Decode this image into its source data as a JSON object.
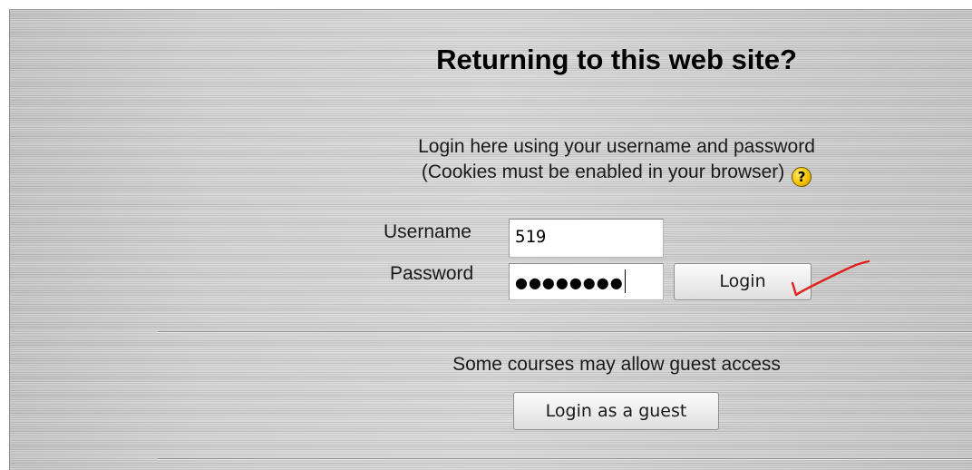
{
  "login_page": {
    "heading": "Returning to this web site?",
    "intro_line1": "Login here using your username and password",
    "intro_line2": "(Cookies must be enabled in your browser)",
    "help_icon": "question-mark-icon",
    "username_label": "Username",
    "username_value": "519",
    "password_label": "Password",
    "password_masked": "●●●●●●●●",
    "login_button": "Login",
    "guest_note": "Some courses may allow guest access",
    "guest_button": "Login as a guest"
  },
  "annotation": {
    "icon": "red-handwritten-checkmark",
    "color": "#e0201e"
  },
  "colors": {
    "panel_background": "#d0d0d0",
    "help_icon": "#f5c400",
    "text": "#1a1a1a"
  }
}
